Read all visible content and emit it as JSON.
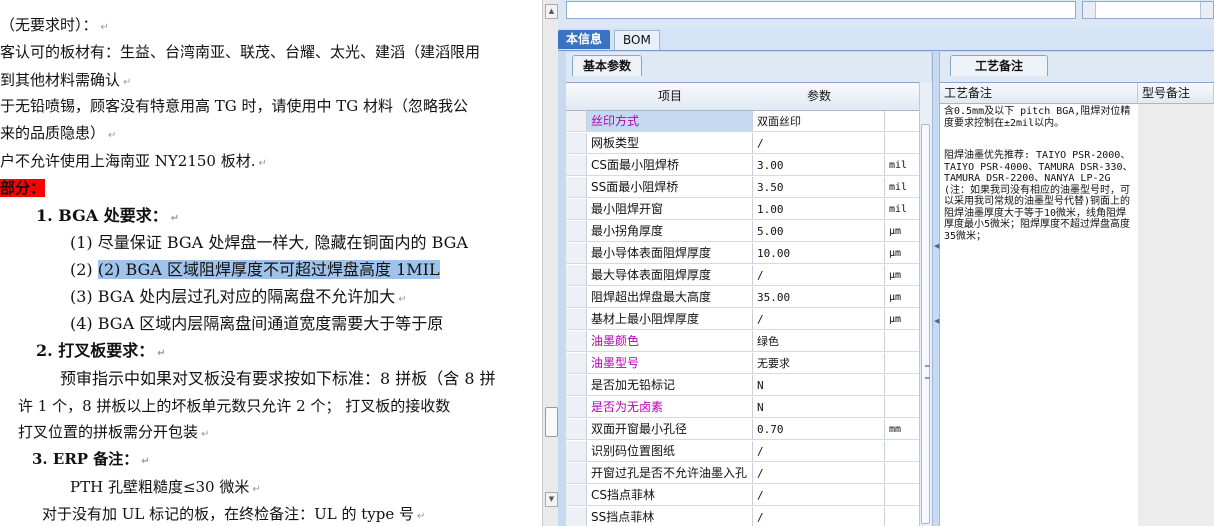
{
  "document": {
    "lines": [
      "（无要求时）：",
      "客认可的板材有：生益、台湾南亚、联茂、台耀、太光、建滔（建滔限用",
      "到其他材料需确认",
      "于无铅喷锡，顾客没有特意用高 TG 时，请使用中 TG 材料（忽略我公",
      "来的品质隐患）",
      "户不允许使用上海南亚 NY2150 板材."
    ],
    "section_mark": "部分：",
    "h1": "1. BGA 处要求：",
    "items": [
      "(1) 尽量保证 BGA 处焊盘一样大, 隐藏在铜面内的 BGA",
      "(2) BGA 区域阻焊厚度不可超过焊盘高度 1MIL",
      "(3) BGA 处内层过孔对应的隔离盘不允许加大",
      "(4) BGA 区域内层隔离盘间通道宽度需要大于等于原"
    ],
    "h2": "2. 打叉板要求：",
    "para1": "预审指示中如果对叉板没有要求按如下标准：8 拼板（含 8 拼",
    "para2": "许 1 个，8 拼板以上的坏板单元数只允许 2 个；  打叉板的接收数",
    "para3": "打叉位置的拼板需分开包装",
    "h3": "3. ERP 备注：",
    "erp1": "PTH 孔壁粗糙度≤30 微米",
    "erp2": "对于没有加 UL 标记的板，在终检备注：UL 的 type 号",
    "para_mark": "↵"
  },
  "app": {
    "tabs": [
      "本信息",
      "BOM"
    ],
    "left_subtab": "基本参数",
    "right_subtab": "工艺备注",
    "grid_headers": [
      "项目",
      "参数"
    ],
    "rows": [
      {
        "name": "丝印方式",
        "value": "双面丝印",
        "unit": "",
        "purple": true,
        "highlight": true
      },
      {
        "name": "网板类型",
        "value": "/",
        "unit": "",
        "purple": false,
        "highlight": false
      },
      {
        "name": "CS面最小阻焊桥",
        "value": "3.00",
        "unit": "mil",
        "purple": false,
        "highlight": false
      },
      {
        "name": "SS面最小阻焊桥",
        "value": "3.50",
        "unit": "mil",
        "purple": false,
        "highlight": false
      },
      {
        "name": "最小阻焊开窗",
        "value": "1.00",
        "unit": "mil",
        "purple": false,
        "highlight": false
      },
      {
        "name": "最小拐角厚度",
        "value": "5.00",
        "unit": "μm",
        "purple": false,
        "highlight": false
      },
      {
        "name": "最小导体表面阻焊厚度",
        "value": "10.00",
        "unit": "μm",
        "purple": false,
        "highlight": false
      },
      {
        "name": "最大导体表面阻焊厚度",
        "value": "/",
        "unit": "μm",
        "purple": false,
        "highlight": false
      },
      {
        "name": "阻焊超出焊盘最大高度",
        "value": "35.00",
        "unit": "μm",
        "purple": false,
        "highlight": false
      },
      {
        "name": "基材上最小阻焊厚度",
        "value": "/",
        "unit": "μm",
        "purple": false,
        "highlight": false
      },
      {
        "name": "油墨颜色",
        "value": "绿色",
        "unit": "",
        "purple": true,
        "highlight": false
      },
      {
        "name": "油墨型号",
        "value": "无要求",
        "unit": "",
        "purple": true,
        "highlight": false
      },
      {
        "name": "是否加无铅标记",
        "value": "N",
        "unit": "",
        "purple": false,
        "highlight": false
      },
      {
        "name": "是否为无卤素",
        "value": "N",
        "unit": "",
        "purple": true,
        "highlight": false
      },
      {
        "name": "双面开窗最小孔径",
        "value": "0.70",
        "unit": "mm",
        "purple": false,
        "highlight": false
      },
      {
        "name": "识别码位置图纸",
        "value": "/",
        "unit": "",
        "purple": false,
        "highlight": false
      },
      {
        "name": "开窗过孔是否不允许油墨入孔",
        "value": "/",
        "unit": "",
        "purple": false,
        "highlight": false
      },
      {
        "name": "CS挡点菲林",
        "value": "/",
        "unit": "",
        "purple": false,
        "highlight": false
      },
      {
        "name": "SS挡点菲林",
        "value": "/",
        "unit": "",
        "purple": false,
        "highlight": false
      }
    ],
    "remark_headers": [
      "工艺备注",
      "型号备注"
    ],
    "remark_para1": "含0.5mm及以下 pitch BGA,阻焊对位精度要求控制在±2mil以内。",
    "remark_para2": "阻焊油墨优先推荐: TAIYO PSR-2000、TAIYO PSR-4000、TAMURA DSR-330、TAMURA DSR-2200、NANYA LP-2G(注：如果我司没有相应的油墨型号时，可以采用我司常规的油墨型号代替)铜面上的阻焊油墨厚度大于等于10微米，线角阻焊厚度最小5微米；阻焊厚度不超过焊盘高度35微米；"
  }
}
